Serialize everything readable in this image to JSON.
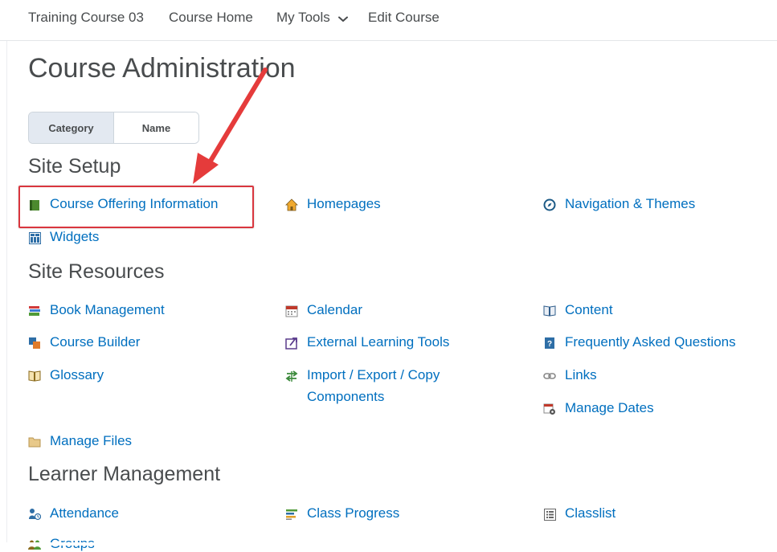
{
  "topnav": {
    "items": [
      "Training Course 03",
      "Course Home",
      "My Tools",
      "Edit Course"
    ]
  },
  "page": {
    "title": "Course Administration"
  },
  "view_toggle": {
    "options": [
      "Category",
      "Name"
    ],
    "selected": "Category"
  },
  "sections": [
    {
      "heading": "Site Setup",
      "links": [
        {
          "label": "Course Offering Information",
          "icon": "book-icon",
          "highlighted": true
        },
        {
          "label": "Homepages",
          "icon": "home-icon"
        },
        {
          "label": "Navigation & Themes",
          "icon": "compass-icon"
        },
        {
          "label": "Widgets",
          "icon": "widgets-icon"
        }
      ]
    },
    {
      "heading": "Site Resources",
      "links": [
        {
          "label": "Book Management",
          "icon": "books-icon"
        },
        {
          "label": "Calendar",
          "icon": "calendar-icon"
        },
        {
          "label": "Content",
          "icon": "open-book-icon"
        },
        {
          "label": "Course Builder",
          "icon": "builder-icon"
        },
        {
          "label": "External Learning Tools",
          "icon": "external-tool-icon"
        },
        {
          "label": "Frequently Asked Questions",
          "icon": "faq-icon"
        },
        {
          "label": "Glossary",
          "icon": "glossary-icon"
        },
        {
          "label": "Import / Export / Copy Components",
          "icon": "import-export-icon"
        },
        {
          "label": "Links",
          "icon": "link-icon"
        },
        {
          "label": "Manage Dates",
          "icon": "calendar-gear-icon"
        },
        {
          "label": "Manage Files",
          "icon": "folder-icon"
        }
      ]
    },
    {
      "heading": "Learner Management",
      "links": [
        {
          "label": "Attendance",
          "icon": "attendance-icon"
        },
        {
          "label": "Class Progress",
          "icon": "progress-icon"
        },
        {
          "label": "Classlist",
          "icon": "classlist-icon"
        },
        {
          "label": "Groups",
          "icon": "groups-icon"
        }
      ]
    }
  ],
  "colors": {
    "link": "#006fbf",
    "text": "#494c4e",
    "highlight": "#d9363e",
    "toggle_active": "#e3e9f1"
  }
}
